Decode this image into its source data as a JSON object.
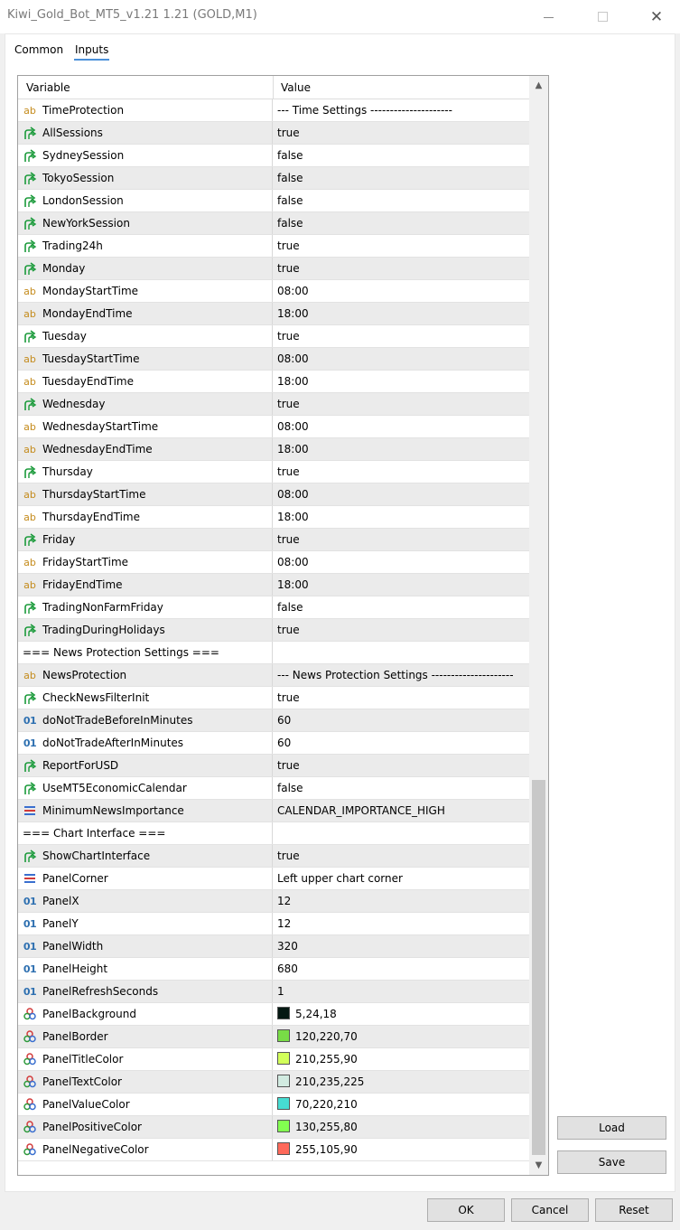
{
  "window": {
    "title": "Kiwi_Gold_Bot_MT5_v1.21 1.21 (GOLD,M1)",
    "minimize": "—",
    "close": "✕"
  },
  "tabs": [
    "Common",
    "Inputs"
  ],
  "grid": {
    "header_variable": "Variable",
    "header_value": "Value"
  },
  "icons": {
    "ab": "ab",
    "01": "01",
    "bool": "bool-arrow-icon",
    "enum": "enum-list-icon",
    "color": "color-palette-icon"
  },
  "rows": [
    {
      "type": "ab",
      "name": "TimeProtection",
      "value": "--- Time Settings ---------------------"
    },
    {
      "type": "bool",
      "name": "AllSessions",
      "value": "true"
    },
    {
      "type": "bool",
      "name": "SydneySession",
      "value": "false"
    },
    {
      "type": "bool",
      "name": "TokyoSession",
      "value": "false"
    },
    {
      "type": "bool",
      "name": "LondonSession",
      "value": "false"
    },
    {
      "type": "bool",
      "name": "NewYorkSession",
      "value": "false"
    },
    {
      "type": "bool",
      "name": "Trading24h",
      "value": "true"
    },
    {
      "type": "bool",
      "name": "Monday",
      "value": "true"
    },
    {
      "type": "ab",
      "name": "MondayStartTime",
      "value": "08:00"
    },
    {
      "type": "ab",
      "name": "MondayEndTime",
      "value": "18:00"
    },
    {
      "type": "bool",
      "name": "Tuesday",
      "value": "true"
    },
    {
      "type": "ab",
      "name": "TuesdayStartTime",
      "value": "08:00"
    },
    {
      "type": "ab",
      "name": "TuesdayEndTime",
      "value": "18:00"
    },
    {
      "type": "bool",
      "name": "Wednesday",
      "value": "true"
    },
    {
      "type": "ab",
      "name": "WednesdayStartTime",
      "value": "08:00"
    },
    {
      "type": "ab",
      "name": "WednesdayEndTime",
      "value": "18:00"
    },
    {
      "type": "bool",
      "name": "Thursday",
      "value": "true"
    },
    {
      "type": "ab",
      "name": "ThursdayStartTime",
      "value": "08:00"
    },
    {
      "type": "ab",
      "name": "ThursdayEndTime",
      "value": "18:00"
    },
    {
      "type": "bool",
      "name": "Friday",
      "value": "true"
    },
    {
      "type": "ab",
      "name": "FridayStartTime",
      "value": "08:00"
    },
    {
      "type": "ab",
      "name": "FridayEndTime",
      "value": "18:00"
    },
    {
      "type": "bool",
      "name": "TradingNonFarmFriday",
      "value": "false"
    },
    {
      "type": "bool",
      "name": "TradingDuringHolidays",
      "value": "true"
    },
    {
      "type": "section",
      "name": "=== News Protection Settings ===",
      "value": ""
    },
    {
      "type": "ab",
      "name": "NewsProtection",
      "value": "--- News Protection Settings ---------------------"
    },
    {
      "type": "bool",
      "name": "CheckNewsFilterInit",
      "value": "true"
    },
    {
      "type": "int",
      "name": "doNotTradeBeforeInMinutes",
      "value": "60"
    },
    {
      "type": "int",
      "name": "doNotTradeAfterInMinutes",
      "value": "60"
    },
    {
      "type": "bool",
      "name": "ReportForUSD",
      "value": "true"
    },
    {
      "type": "bool",
      "name": "UseMT5EconomicCalendar",
      "value": "false"
    },
    {
      "type": "enum",
      "name": "MinimumNewsImportance",
      "value": "CALENDAR_IMPORTANCE_HIGH"
    },
    {
      "type": "section",
      "name": "=== Chart Interface ===",
      "value": ""
    },
    {
      "type": "bool",
      "name": "ShowChartInterface",
      "value": "true"
    },
    {
      "type": "enum",
      "name": "PanelCorner",
      "value": "Left upper chart corner"
    },
    {
      "type": "int",
      "name": "PanelX",
      "value": "12"
    },
    {
      "type": "int",
      "name": "PanelY",
      "value": "12"
    },
    {
      "type": "int",
      "name": "PanelWidth",
      "value": "320"
    },
    {
      "type": "int",
      "name": "PanelHeight",
      "value": "680"
    },
    {
      "type": "int",
      "name": "PanelRefreshSeconds",
      "value": "1"
    },
    {
      "type": "color",
      "name": "PanelBackground",
      "value": "5,24,18",
      "swatch": "#051812"
    },
    {
      "type": "color",
      "name": "PanelBorder",
      "value": "120,220,70",
      "swatch": "#78dc46"
    },
    {
      "type": "color",
      "name": "PanelTitleColor",
      "value": "210,255,90",
      "swatch": "#d2ff5a"
    },
    {
      "type": "color",
      "name": "PanelTextColor",
      "value": "210,235,225",
      "swatch": "#d2ebe1"
    },
    {
      "type": "color",
      "name": "PanelValueColor",
      "value": "70,220,210",
      "swatch": "#46dcd2"
    },
    {
      "type": "color",
      "name": "PanelPositiveColor",
      "value": "130,255,80",
      "swatch": "#82ff50"
    },
    {
      "type": "color",
      "name": "PanelNegativeColor",
      "value": "255,105,90",
      "swatch": "#ff695a"
    }
  ],
  "buttons": {
    "load": "Load",
    "save": "Save",
    "ok": "OK",
    "cancel": "Cancel",
    "reset": "Reset"
  },
  "colors": {
    "bool_icon": "#1a9a3a",
    "ab_icon": "#c48a1a",
    "int_icon": "#2d6fb0",
    "enum_icon_top": "#3a6fcf",
    "enum_icon_mid": "#d23a3a"
  }
}
